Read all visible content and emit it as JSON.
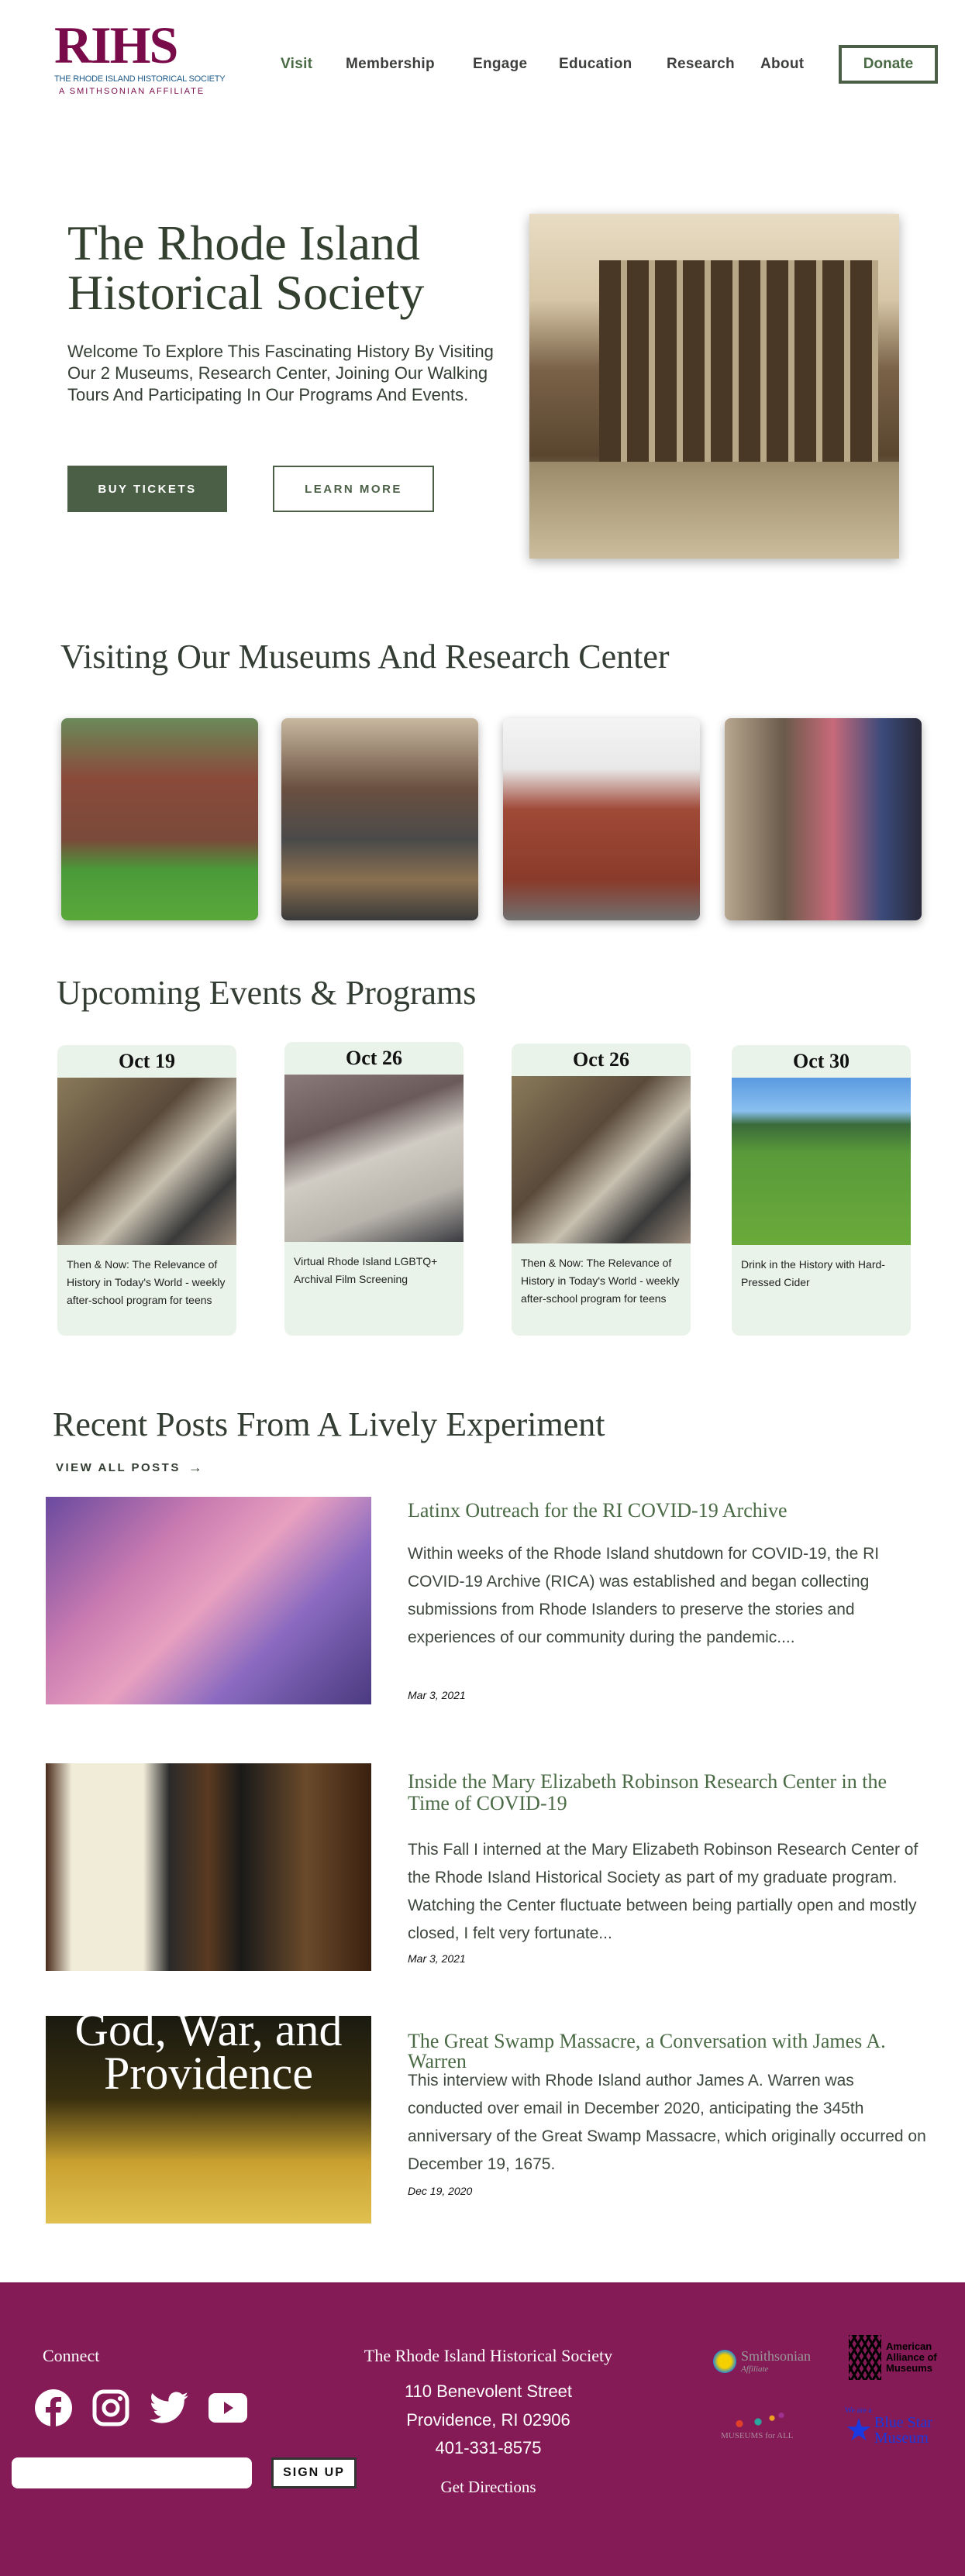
{
  "header": {
    "logo": {
      "letters": "RIHS",
      "line1": "THE RHODE ISLAND HISTORICAL SOCIETY",
      "line2": "A SMITHSONIAN AFFILIATE"
    },
    "nav": [
      "Visit",
      "Membership",
      "Engage",
      "Education",
      "Research",
      "About"
    ],
    "donate_label": "Donate"
  },
  "hero": {
    "title": "The Rhode Island Historical Society",
    "text": "Welcome To Explore This Fascinating History By Visiting Our 2 Museums, Research Center, Joining Our Walking Tours And Participating In Our Programs And Events.",
    "buy_label": "BUY TICKETS",
    "learn_label": "LEARN MORE"
  },
  "visiting": {
    "title": "Visiting Our Museums And Research Center"
  },
  "events": {
    "title": "Upcoming Events & Programs",
    "items": [
      {
        "date": "Oct 19",
        "title": "Then & Now: The Relevance of History in Today's World - weekly after-school program for teens"
      },
      {
        "date": "Oct 26",
        "title": "Virtual Rhode Island LGBTQ+ Archival Film Screening"
      },
      {
        "date": "Oct 26",
        "title": "Then & Now: The Relevance of History in Today's World - weekly after-school program for teens"
      },
      {
        "date": "Oct 30",
        "title": "Drink in the History with Hard-Pressed Cider"
      }
    ]
  },
  "posts": {
    "title": "Recent Posts From A Lively Experiment",
    "view_all": "VIEW ALL POSTS",
    "items": [
      {
        "title": "Latinx Outreach for the RI COVID-19 Archive",
        "excerpt": "Within weeks of the Rhode Island shutdown for COVID-19, the RI COVID-19 Archive (RICA) was established and began collecting submissions from Rhode Islanders to preserve the stories and experiences of our community during the pandemic....",
        "date": "Mar 3, 2021"
      },
      {
        "title": "Inside the Mary Elizabeth Robinson Research Center in the Time of COVID-19",
        "excerpt": "This Fall I interned at the Mary Elizabeth Robinson Research Center of the Rhode Island Historical Society as part of my graduate program. Watching the Center fluctuate between being partially open and mostly closed, I felt very fortunate...",
        "date": "Mar 3, 2021"
      },
      {
        "title": "The Great Swamp Massacre, a Conversation with James A. Warren",
        "excerpt": "This interview with Rhode Island author James A. Warren was conducted over email in December 2020, anticipating the 345th anniversary of the Great Swamp Massacre, which originally occurred on December 19, 1675.",
        "date": "Dec 19, 2020",
        "image_text": "God, War, and Providence"
      }
    ]
  },
  "footer": {
    "connect": "Connect",
    "signup_label": "SIGN UP",
    "email_placeholder": "",
    "org": "The Rhode Island Historical Society",
    "street": "110 Benevolent Street",
    "city": "Providence, RI 02906",
    "phone": "401-331-8575",
    "directions": "Get Directions",
    "logos": {
      "smithsonian": "Smithsonian",
      "smithsonian_sub": "Affiliate",
      "aam": "American Alliance of Museums",
      "mfa": "MUSEUMS for ALL",
      "bluestar_pre": "We are a",
      "bluestar": "Blue Star Museum"
    }
  },
  "colors": {
    "green": "#4a5f45",
    "footer": "#841a56",
    "card": "#eaf3ea"
  }
}
